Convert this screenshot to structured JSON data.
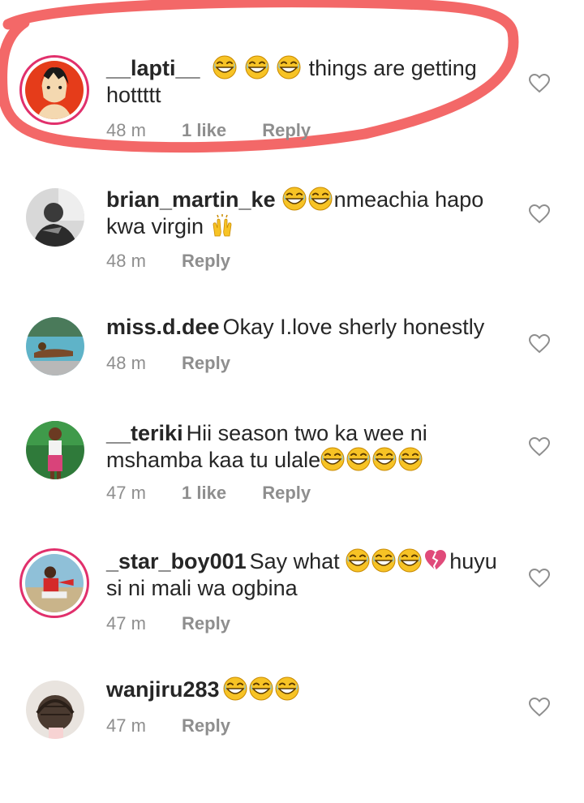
{
  "comments": [
    {
      "username": "__lapti__",
      "emojis_before": [
        "grin-squint",
        "grin-squint",
        "grin-squint"
      ],
      "text": "things are getting hottttt",
      "time": "48 m",
      "likes": "1 like",
      "reply": "Reply",
      "ring": true,
      "highlighted": true
    },
    {
      "username": "brian_martin_ke",
      "text": "nmeachia hapo kwa virgin",
      "time": "48 m",
      "reply": "Reply"
    },
    {
      "username": "miss.d.dee",
      "text": "Okay I.love sherly honestly",
      "time": "48 m",
      "reply": "Reply"
    },
    {
      "username": "__teriki",
      "text": "Hii season two ka wee ni mshamba kaa tu ulale",
      "time": "47 m",
      "likes": "1 like",
      "reply": "Reply"
    },
    {
      "username": "_star_boy001",
      "text_a": "Say what",
      "text_b": "huyu si ni mali wa ogbina",
      "time": "47 m",
      "reply": "Reply",
      "ring": true
    },
    {
      "username": "wanjiru283",
      "text": "",
      "time": "47 m",
      "reply": "Reply"
    }
  ],
  "colors": {
    "highlight_stroke": "#f25b5b",
    "story_ring": "#e1306c",
    "meta_text": "#8e8e8e"
  }
}
